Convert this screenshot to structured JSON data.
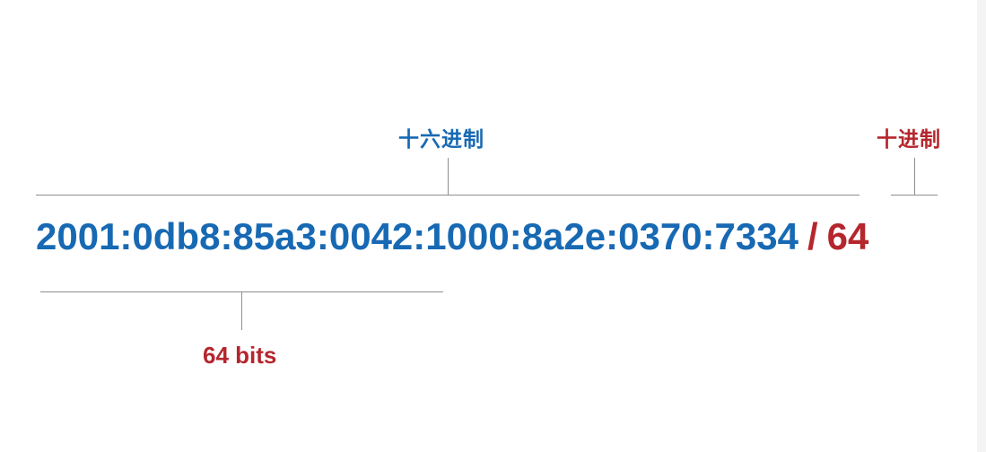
{
  "labels": {
    "hex": "十六进制",
    "decimal": "十进制",
    "bits": "64 bits"
  },
  "address": {
    "hex_part": "2001:0db8:85a3:0042:1000:8a2e:0370:7334",
    "separator": "/",
    "prefix_length": "64"
  },
  "colors": {
    "blue": "#1769b3",
    "red": "#b5262d",
    "line": "#8e8e8e"
  }
}
